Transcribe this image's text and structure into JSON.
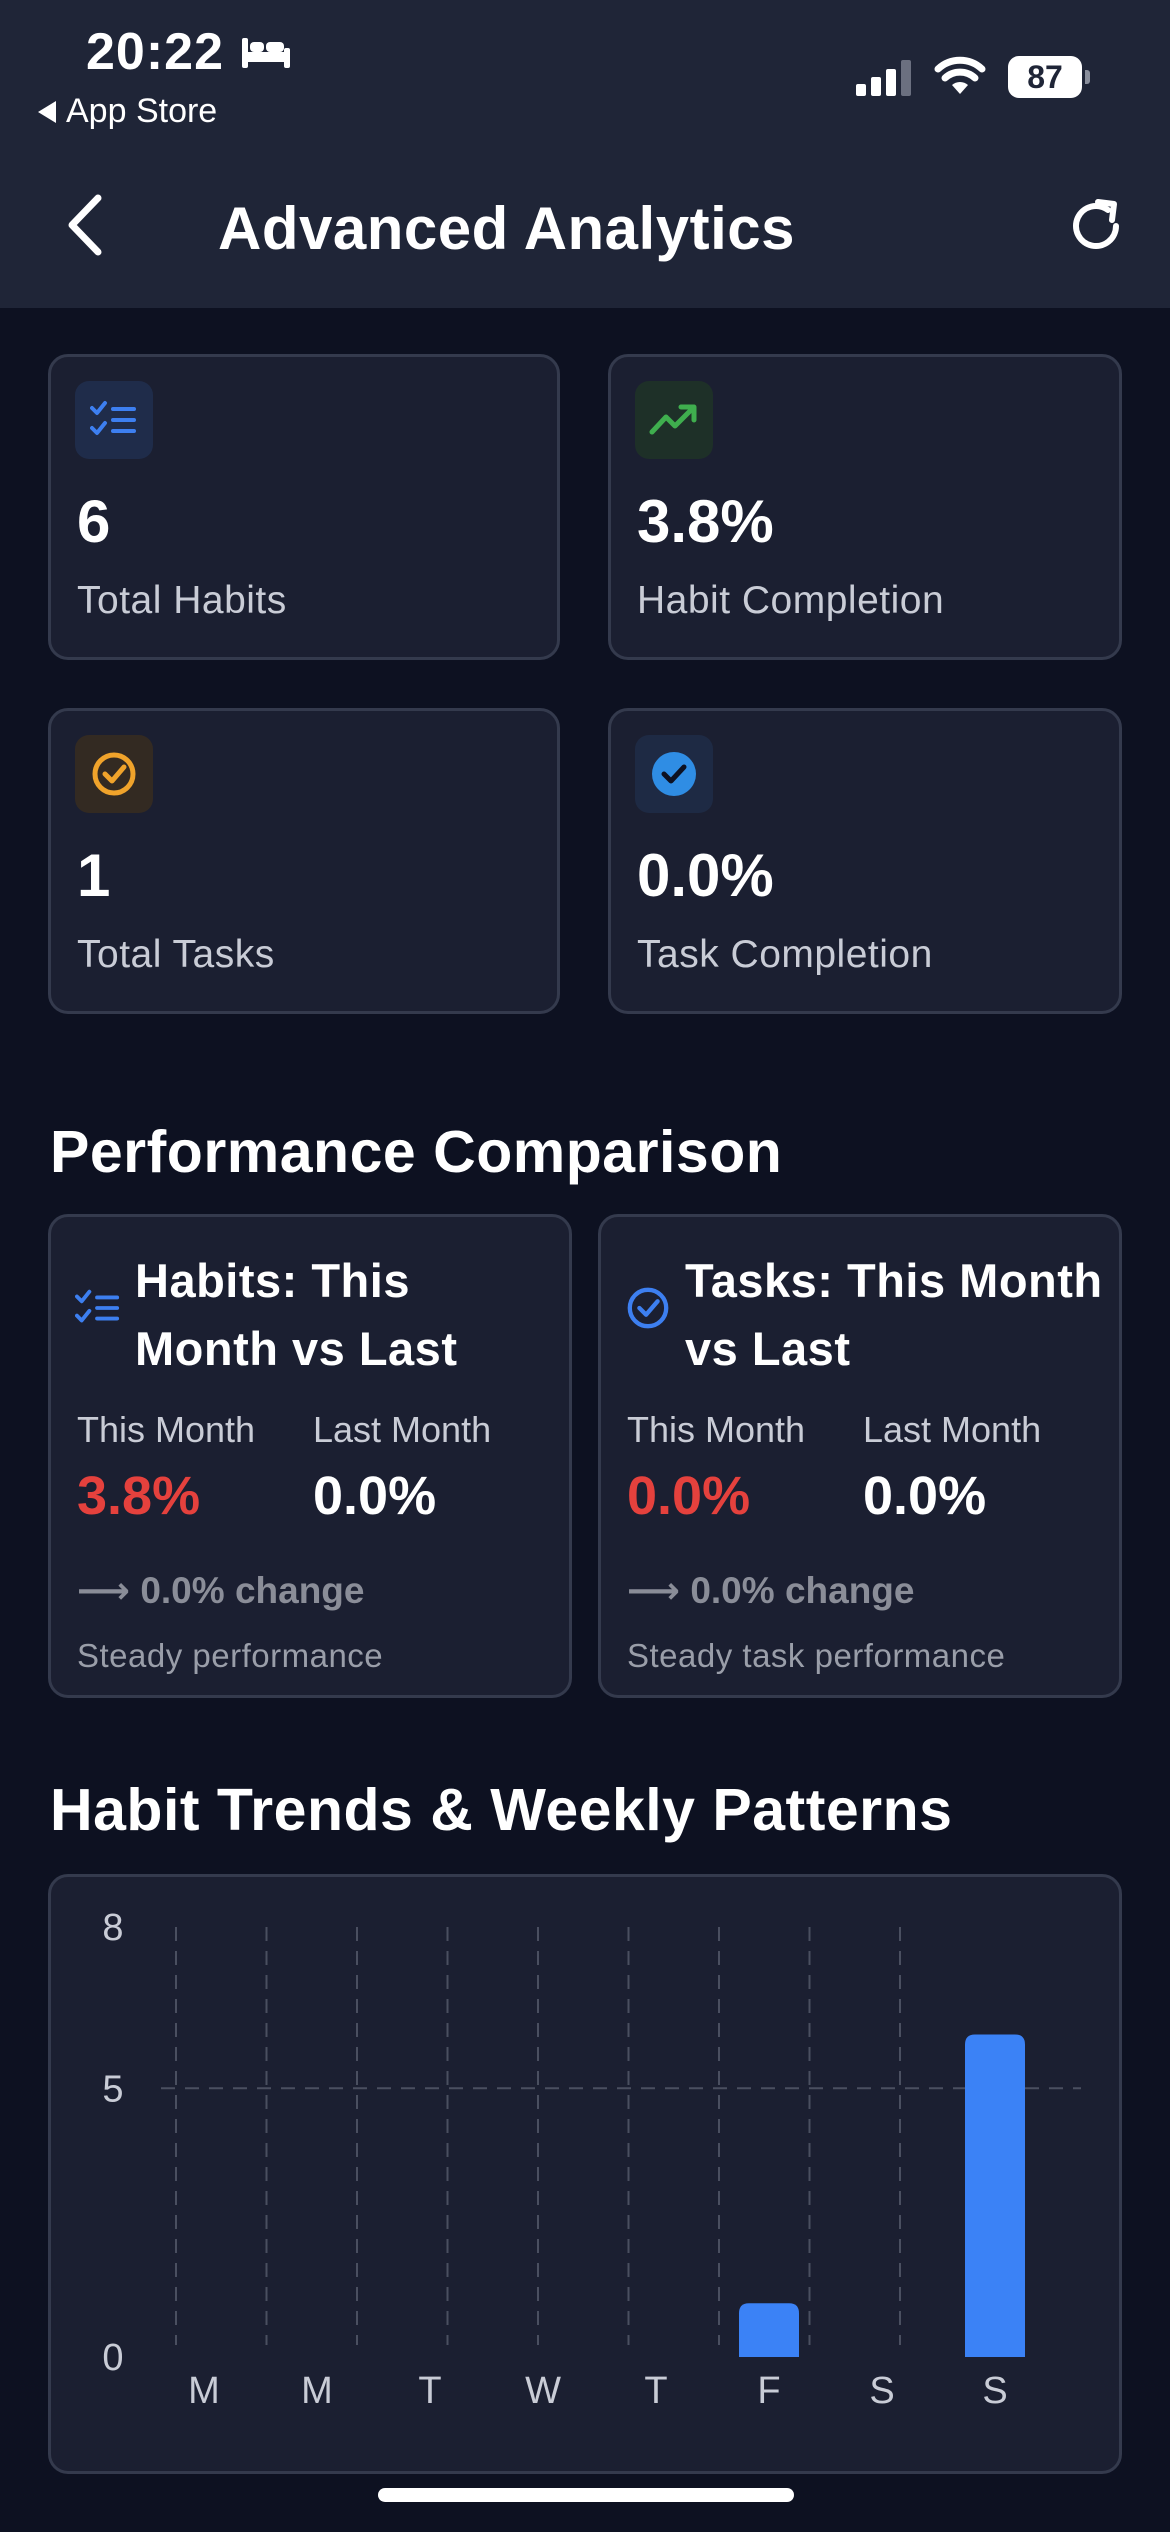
{
  "status_bar": {
    "time": "20:22",
    "back_app": "App Store",
    "battery": "87"
  },
  "nav": {
    "title": "Advanced Analytics"
  },
  "stats": [
    {
      "value": "6",
      "label": "Total Habits",
      "icon": "checklist-icon",
      "color": "#3d7ff0"
    },
    {
      "value": "3.8%",
      "label": "Habit Completion",
      "icon": "trending-up-icon",
      "color": "#3fae4e"
    },
    {
      "value": "1",
      "label": "Total Tasks",
      "icon": "check-circle-outline-icon",
      "color": "#f0a32b"
    },
    {
      "value": "0.0%",
      "label": "Task Completion",
      "icon": "check-circle-filled-icon",
      "color": "#2f8de4"
    }
  ],
  "performance": {
    "title": "Performance Comparison",
    "habits": {
      "title": "Habits: This Month vs Last",
      "this_month_label": "This Month",
      "last_month_label": "Last Month",
      "this_month_value": "3.8%",
      "last_month_value": "0.0%",
      "change": "0.0% change",
      "note": "Steady performance"
    },
    "tasks": {
      "title": "Tasks: This Month vs Last",
      "this_month_label": "This Month",
      "last_month_label": "Last Month",
      "this_month_value": "0.0%",
      "last_month_value": "0.0%",
      "change": "0.0% change",
      "note": "Steady task performance"
    },
    "colors": {
      "negative": "#e5413d",
      "neutral": "#8a8d98"
    }
  },
  "trends": {
    "title": "Habit Trends & Weekly Patterns"
  },
  "chart_data": {
    "type": "bar",
    "categories": [
      "M",
      "M",
      "T",
      "W",
      "T",
      "F",
      "S",
      "S"
    ],
    "values": [
      0,
      0,
      0,
      0,
      0,
      1,
      0,
      6
    ],
    "ylim": [
      0,
      8
    ],
    "yticks": [
      0,
      5,
      8
    ],
    "grid": true,
    "bar_color": "#3b82f6"
  }
}
